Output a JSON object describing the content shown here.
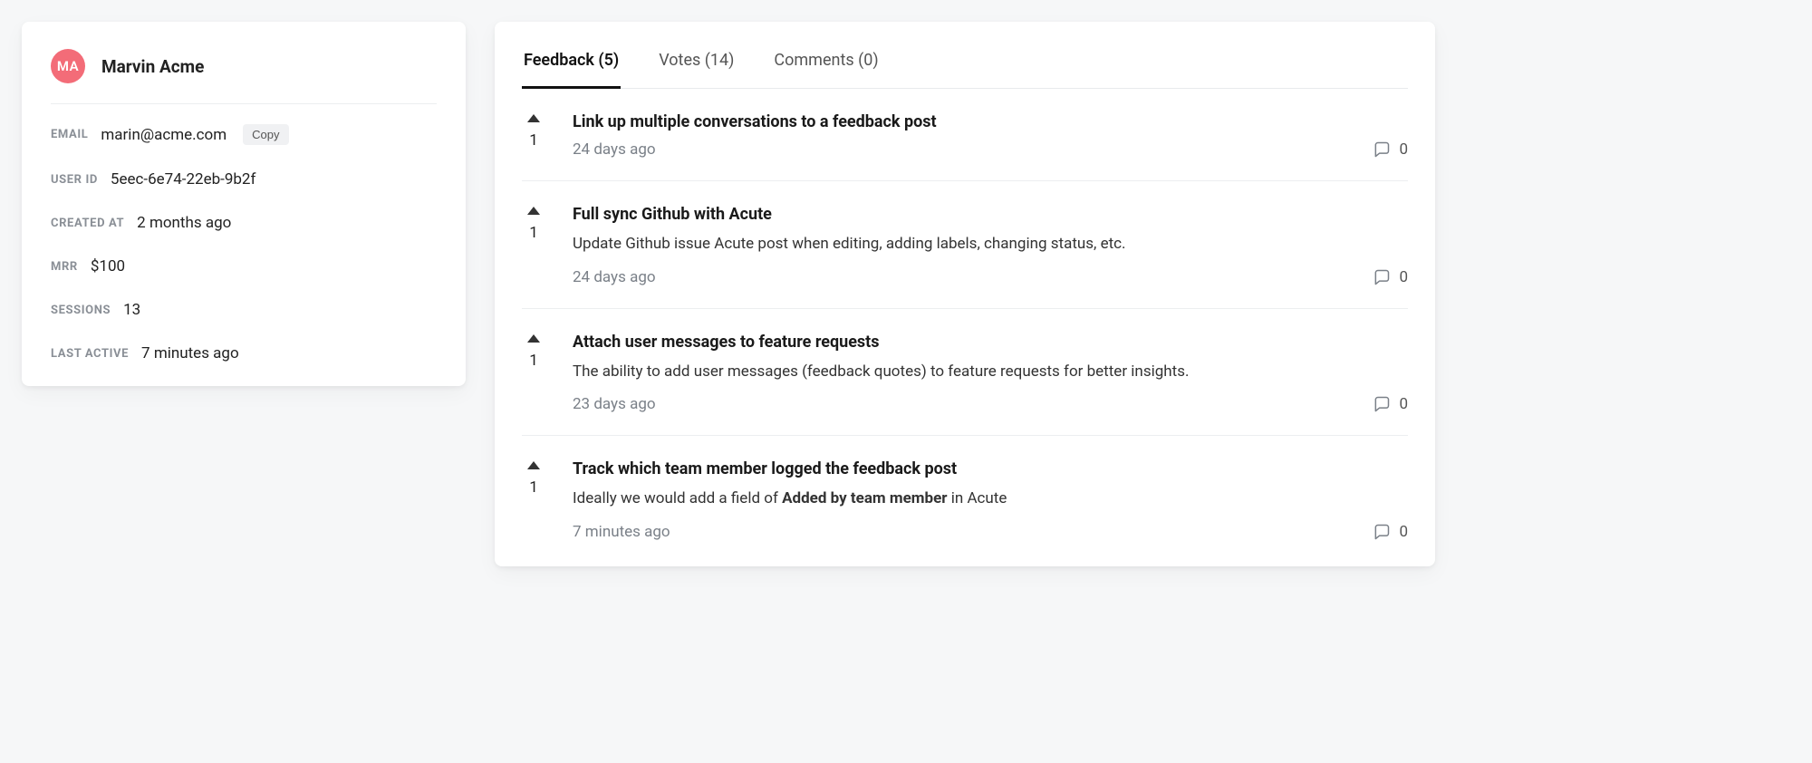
{
  "profile": {
    "initials": "MA",
    "name": "Marvin Acme",
    "fields": [
      {
        "label": "EMAIL",
        "value": "marin@acme.com",
        "copy": true
      },
      {
        "label": "USER ID",
        "value": "5eec-6e74-22eb-9b2f"
      },
      {
        "label": "CREATED AT",
        "value": "2 months ago"
      },
      {
        "label": "MRR",
        "value": "$100"
      },
      {
        "label": "SESSIONS",
        "value": "13"
      },
      {
        "label": "LAST ACTIVE",
        "value": "7 minutes ago"
      }
    ],
    "copy_label": "Copy"
  },
  "tabs": [
    {
      "label": "Feedback (5)",
      "active": true
    },
    {
      "label": "Votes (14)",
      "active": false
    },
    {
      "label": "Comments (0)",
      "active": false
    }
  ],
  "feedback": [
    {
      "votes": 1,
      "title": "Link up multiple conversations to a feedback post",
      "description": "",
      "time": "24 days ago",
      "comments": 0
    },
    {
      "votes": 1,
      "title": "Full sync Github with Acute",
      "description": "Update Github issue Acute post when editing, adding labels, changing status, etc.",
      "time": "24 days ago",
      "comments": 0
    },
    {
      "votes": 1,
      "title": "Attach user messages to feature requests",
      "description": "The ability to add user messages (feedback quotes) to feature requests for better insights.",
      "time": "23 days ago",
      "comments": 0
    },
    {
      "votes": 1,
      "title": "Track which team member logged the feedback post",
      "description_html": "Ideally we would add a field of <strong>Added by team member</strong> in Acute",
      "time": "7 minutes ago",
      "comments": 0
    }
  ]
}
